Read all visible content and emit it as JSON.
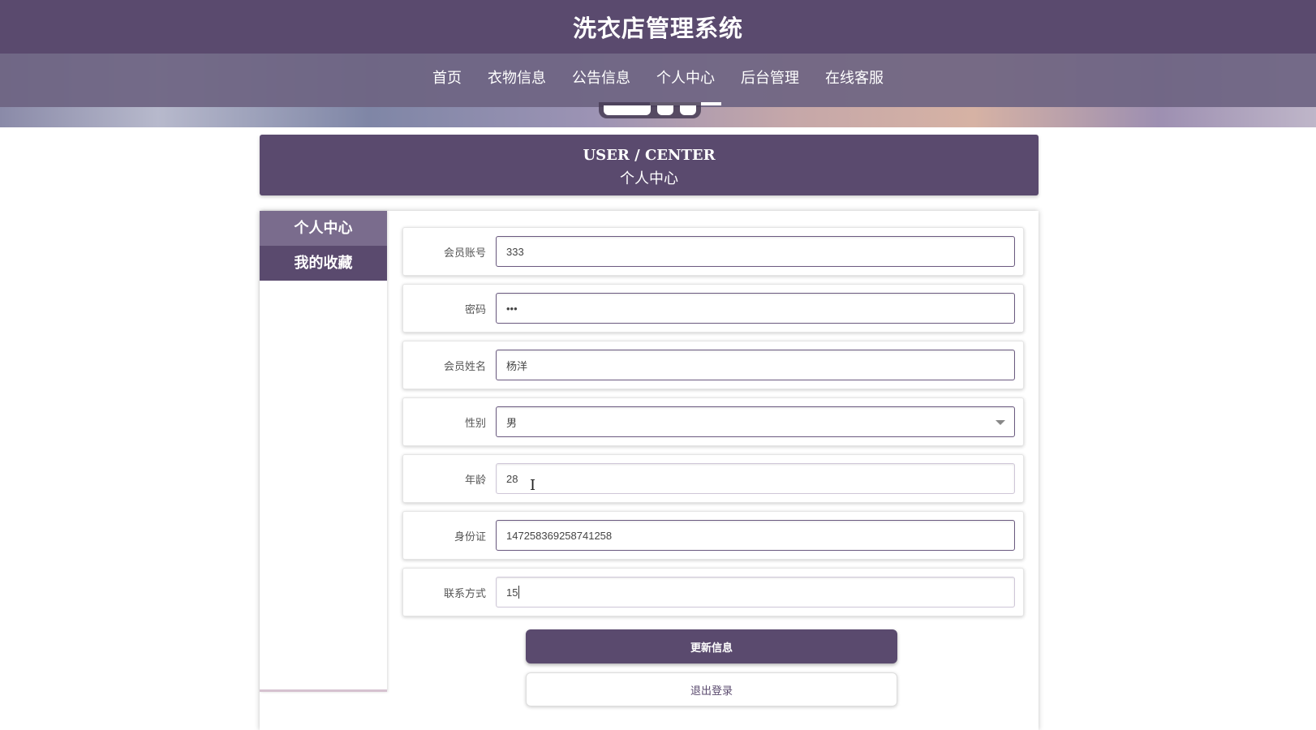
{
  "header": {
    "title": "洗衣店管理系统"
  },
  "nav": {
    "items": [
      {
        "label": "首页"
      },
      {
        "label": "衣物信息"
      },
      {
        "label": "公告信息"
      },
      {
        "label": "个人中心"
      },
      {
        "label": "后台管理"
      },
      {
        "label": "在线客服"
      }
    ],
    "active": "个人中心"
  },
  "section": {
    "title_en": "USER / CENTER",
    "title_cn": "个人中心"
  },
  "sidebar": {
    "items": [
      {
        "label": "个人中心"
      },
      {
        "label": "我的收藏"
      }
    ]
  },
  "form": {
    "account": {
      "label": "会员账号",
      "value": "333"
    },
    "password": {
      "label": "密码",
      "value": "•••"
    },
    "name": {
      "label": "会员姓名",
      "value": "杨洋"
    },
    "gender": {
      "label": "性别",
      "value": "男"
    },
    "age": {
      "label": "年龄",
      "value": "28"
    },
    "id_card": {
      "label": "身份证",
      "value": "147258369258741258"
    },
    "contact": {
      "label": "联系方式",
      "value": "15"
    }
  },
  "buttons": {
    "update": "更新信息",
    "logout": "退出登录"
  },
  "colors": {
    "primary": "#5a4a6e",
    "nav": "#6e6482",
    "sidebar_active": "#7a6c8d"
  }
}
